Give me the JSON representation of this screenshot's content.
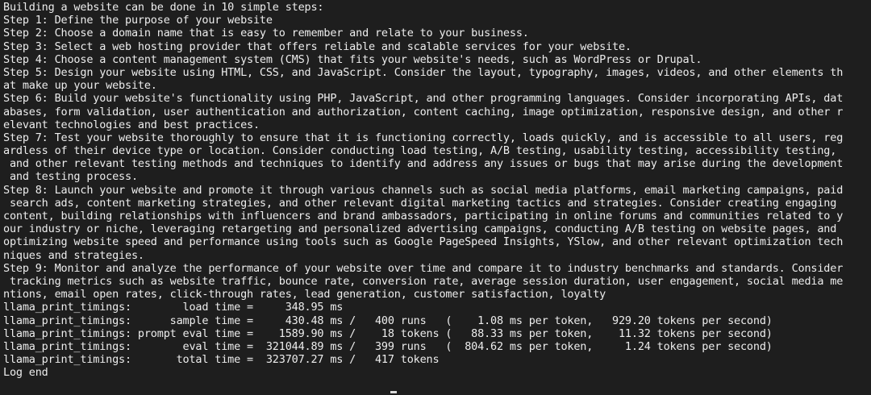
{
  "terminal": {
    "lines": [
      "Building a website can be done in 10 simple steps:",
      "Step 1: Define the purpose of your website",
      "Step 2: Choose a domain name that is easy to remember and relate to your business.",
      "Step 3: Select a web hosting provider that offers reliable and scalable services for your website.",
      "Step 4: Choose a content management system (CMS) that fits your website's needs, such as WordPress or Drupal.",
      "Step 5: Design your website using HTML, CSS, and JavaScript. Consider the layout, typography, images, videos, and other elements th",
      "at make up your website.",
      "Step 6: Build your website's functionality using PHP, JavaScript, and other programming languages. Consider incorporating APIs, dat",
      "abases, form validation, user authentication and authorization, content caching, image optimization, responsive design, and other r",
      "elevant technologies and best practices.",
      "Step 7: Test your website thoroughly to ensure that it is functioning correctly, loads quickly, and is accessible to all users, reg",
      "ardless of their device type or location. Consider conducting load testing, A/B testing, usability testing, accessibility testing,",
      " and other relevant testing methods and techniques to identify and address any issues or bugs that may arise during the development",
      " and testing process.",
      "Step 8: Launch your website and promote it through various channels such as social media platforms, email marketing campaigns, paid",
      " search ads, content marketing strategies, and other relevant digital marketing tactics and strategies. Consider creating engaging",
      "content, building relationships with influencers and brand ambassadors, participating in online forums and communities related to y",
      "our industry or niche, leveraging retargeting and personalized advertising campaigns, conducting A/B testing on website pages, and",
      "optimizing website speed and performance using tools such as Google PageSpeed Insights, YSlow, and other relevant optimization tech",
      "niques and strategies.",
      "Step 9: Monitor and analyze the performance of your website over time and compare it to industry benchmarks and standards. Consider",
      " tracking metrics such as website traffic, bounce rate, conversion rate, average session duration, user engagement, social media me",
      "ntions, email open rates, click-through rates, lead generation, customer satisfaction, loyalty",
      "llama_print_timings:        load time =     348.95 ms",
      "llama_print_timings:      sample time =     430.48 ms /   400 runs   (    1.08 ms per token,   929.20 tokens per second)",
      "llama_print_timings: prompt eval time =    1589.90 ms /    18 tokens (   88.33 ms per token,    11.32 tokens per second)",
      "llama_print_timings:        eval time =  321044.89 ms /   399 runs   (  804.62 ms per token,     1.24 tokens per second)",
      "llama_print_timings:       total time =  323707.27 ms /   417 tokens",
      "Log end"
    ]
  }
}
